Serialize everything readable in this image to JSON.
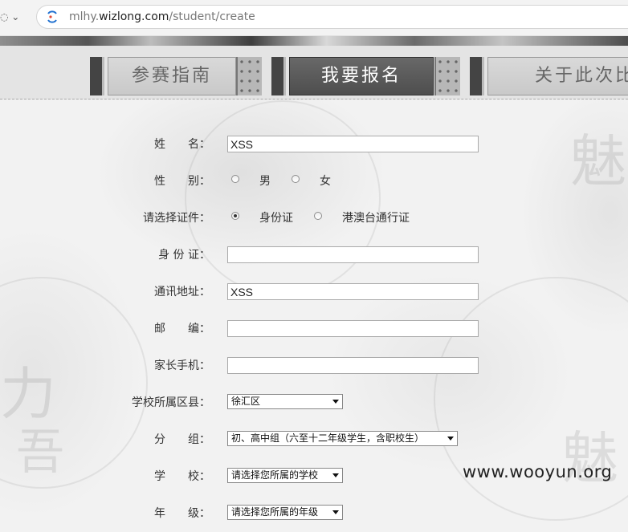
{
  "browser": {
    "url_prefix": "mlhy.",
    "url_domain": "wizlong.com",
    "url_path": "/student/create"
  },
  "nav": {
    "tabs": [
      {
        "label": "参赛指南",
        "active": false
      },
      {
        "label": "我要报名",
        "active": true
      },
      {
        "label": "关于此次比",
        "active": false
      }
    ]
  },
  "form": {
    "name_label": "姓　　名：",
    "name_value": "XSS",
    "gender_label": "性　　别：",
    "gender_male": "男",
    "gender_female": "女",
    "idtype_label": "请选择证件：",
    "idtype_option1": "身份证",
    "idtype_option2": "港澳台通行证",
    "idcard_label": "身 份 证：",
    "idcard_value": "",
    "address_label": "通讯地址：",
    "address_value": "XSS",
    "postcode_label": "邮　　编：",
    "postcode_value": "",
    "phone_label": "家长手机：",
    "phone_value": "",
    "district_label": "学校所属区县：",
    "district_value": "徐汇区",
    "group_label": "分　　组：",
    "group_value": "初、高中组（六至十二年级学生，含职校生）",
    "school_label": "学　　校：",
    "school_value": "请选择您所属的学校",
    "grade_label": "年　　级：",
    "grade_value": "请选择您所属的年级"
  },
  "watermark": "www.wooyun.org"
}
